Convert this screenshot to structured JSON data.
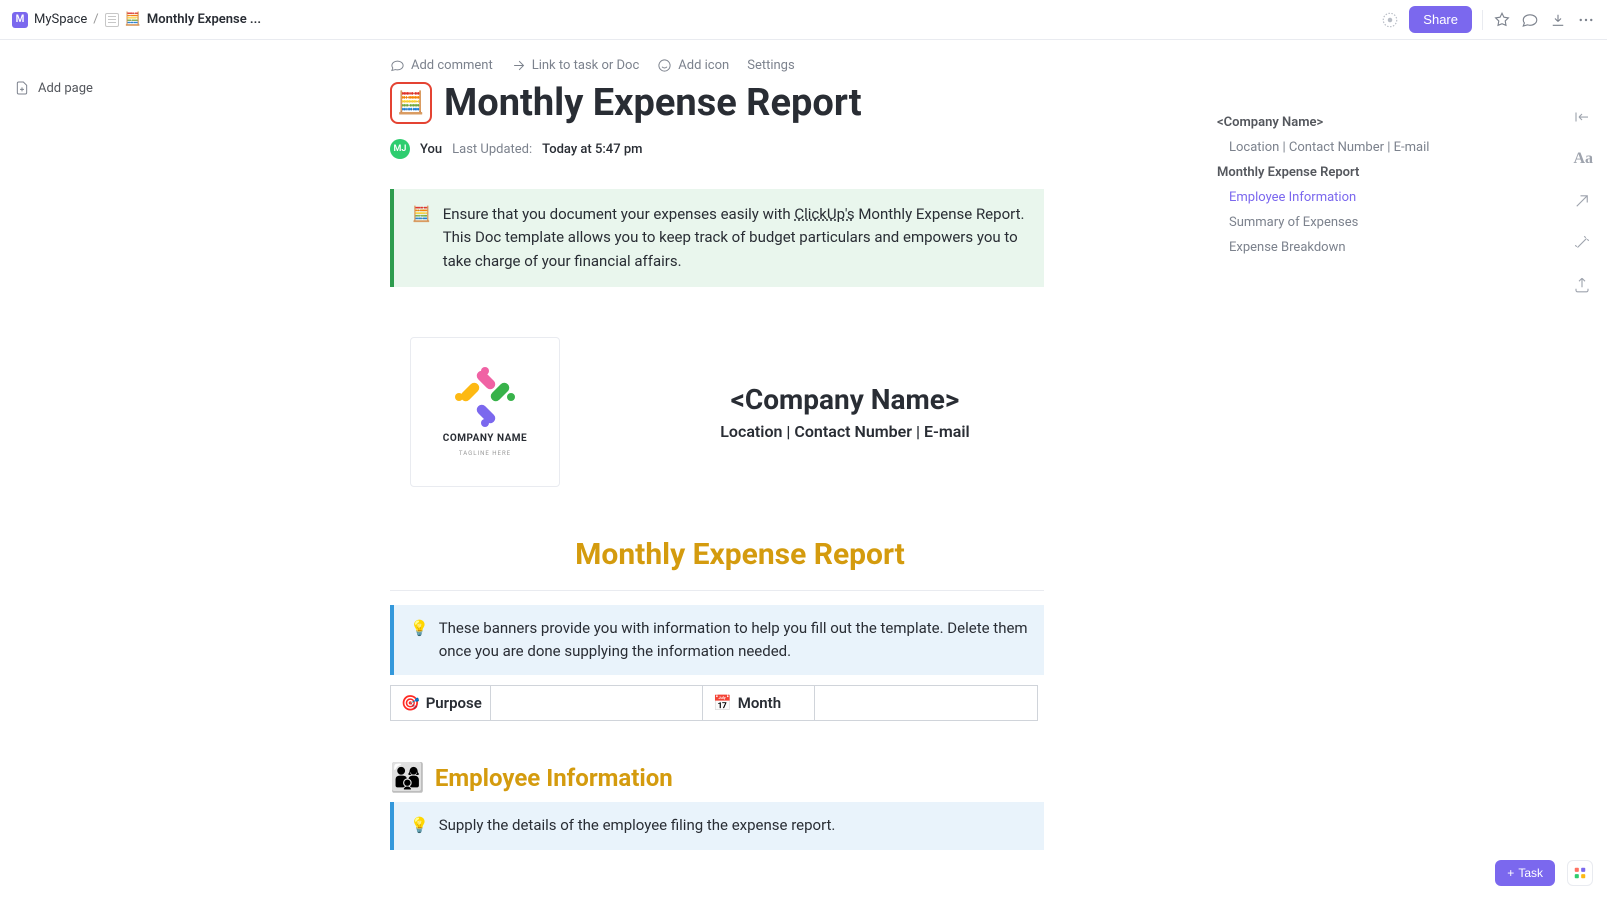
{
  "breadcrumb": {
    "space_badge": "M",
    "space": "MySpace",
    "doc_name": "Monthly Expense ..."
  },
  "topbar": {
    "share": "Share"
  },
  "sidebar": {
    "add_page": "Add page"
  },
  "actions": {
    "add_comment": "Add comment",
    "link_task": "Link to task or Doc",
    "add_icon": "Add icon",
    "settings": "Settings"
  },
  "page": {
    "title": "Monthly Expense Report",
    "author": "You",
    "avatar_initials": "MJ",
    "updated_label": "Last Updated:",
    "updated_value": "Today at 5:47 pm"
  },
  "callout_intro": {
    "text_a": "Ensure that you document your expenses easily with ",
    "link": "ClickUp's",
    "text_b": " Monthly Expense Report. This Doc template allows you to keep track of budget particulars and empowers you to take charge of your financial affairs."
  },
  "company": {
    "logo_name": "COMPANY NAME",
    "logo_tag": "TAGLINE HERE",
    "name": "<Company Name>",
    "sub": "Location | Contact Number | E-mail"
  },
  "section_report_title": "Monthly Expense Report",
  "callout_banners": "These banners provide you with information to help you fill out the template. Delete them once you are done supplying the information needed.",
  "table": {
    "purpose": "Purpose",
    "month": "Month"
  },
  "emp_section": {
    "title": "Employee Information",
    "callout": "Supply the details of the employee filing the expense report."
  },
  "outline": {
    "items": [
      {
        "label": "<Company Name>",
        "bold": true,
        "sub": false,
        "active": false
      },
      {
        "label": "Location | Contact Number | E-mail",
        "bold": false,
        "sub": true,
        "active": false
      },
      {
        "label": "Monthly Expense Report",
        "bold": true,
        "sub": false,
        "active": false
      },
      {
        "label": "Employee Information",
        "bold": false,
        "sub": true,
        "active": true
      },
      {
        "label": "Summary of Expenses",
        "bold": false,
        "sub": true,
        "active": false
      },
      {
        "label": "Expense Breakdown",
        "bold": false,
        "sub": true,
        "active": false
      }
    ]
  },
  "task_button": "Task"
}
